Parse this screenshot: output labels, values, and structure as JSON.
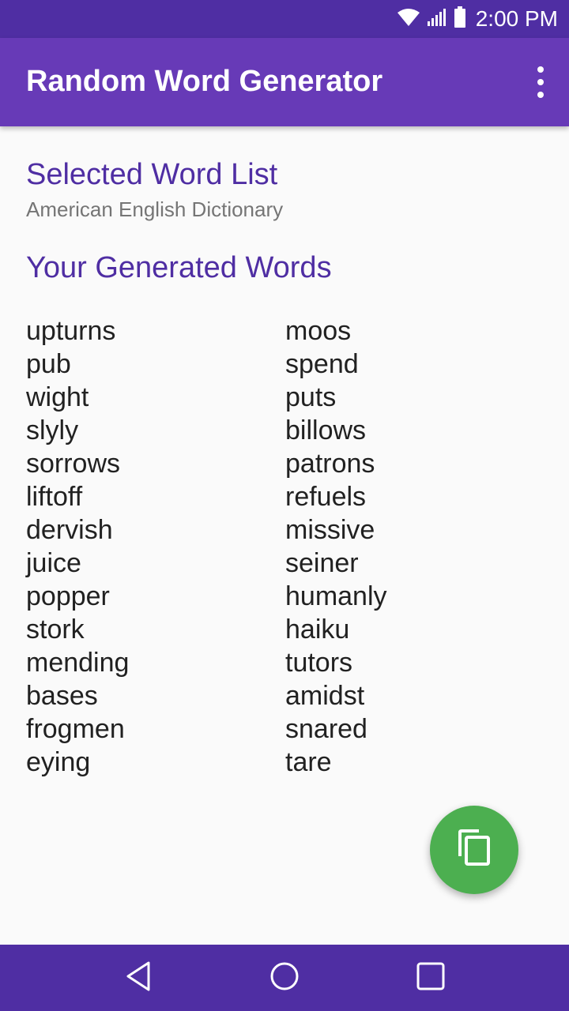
{
  "status_bar": {
    "time": "2:00 PM",
    "icons": [
      "wifi-icon",
      "signal-icon",
      "battery-icon"
    ]
  },
  "app_bar": {
    "title": "Random Word Generator",
    "overflow_icon": "more-vert-icon"
  },
  "selected_list": {
    "heading": "Selected Word List",
    "value": "American English Dictionary"
  },
  "generated": {
    "heading": "Your Generated Words",
    "column_1": [
      "upturns",
      "pub",
      "wight",
      "slyly",
      "sorrows",
      "liftoff",
      "dervish",
      "juice",
      "popper",
      "stork",
      "mending",
      "bases",
      "frogmen",
      "eying"
    ],
    "column_2": [
      "moos",
      "spend",
      "puts",
      "billows",
      "patrons",
      "refuels",
      "missive",
      "seiner",
      "humanly",
      "haiku",
      "tutors",
      "amidst",
      "snared",
      "tare"
    ]
  },
  "fab": {
    "icon": "copy-icon"
  },
  "nav_bar": {
    "icons": [
      "back-icon",
      "home-icon",
      "recents-icon"
    ]
  },
  "colors": {
    "status_bar": "#4f2ea3",
    "app_bar": "#673ab7",
    "accent_text": "#4f2ea3",
    "fab": "#4caf50",
    "nav_bar": "#4f2ea3"
  }
}
